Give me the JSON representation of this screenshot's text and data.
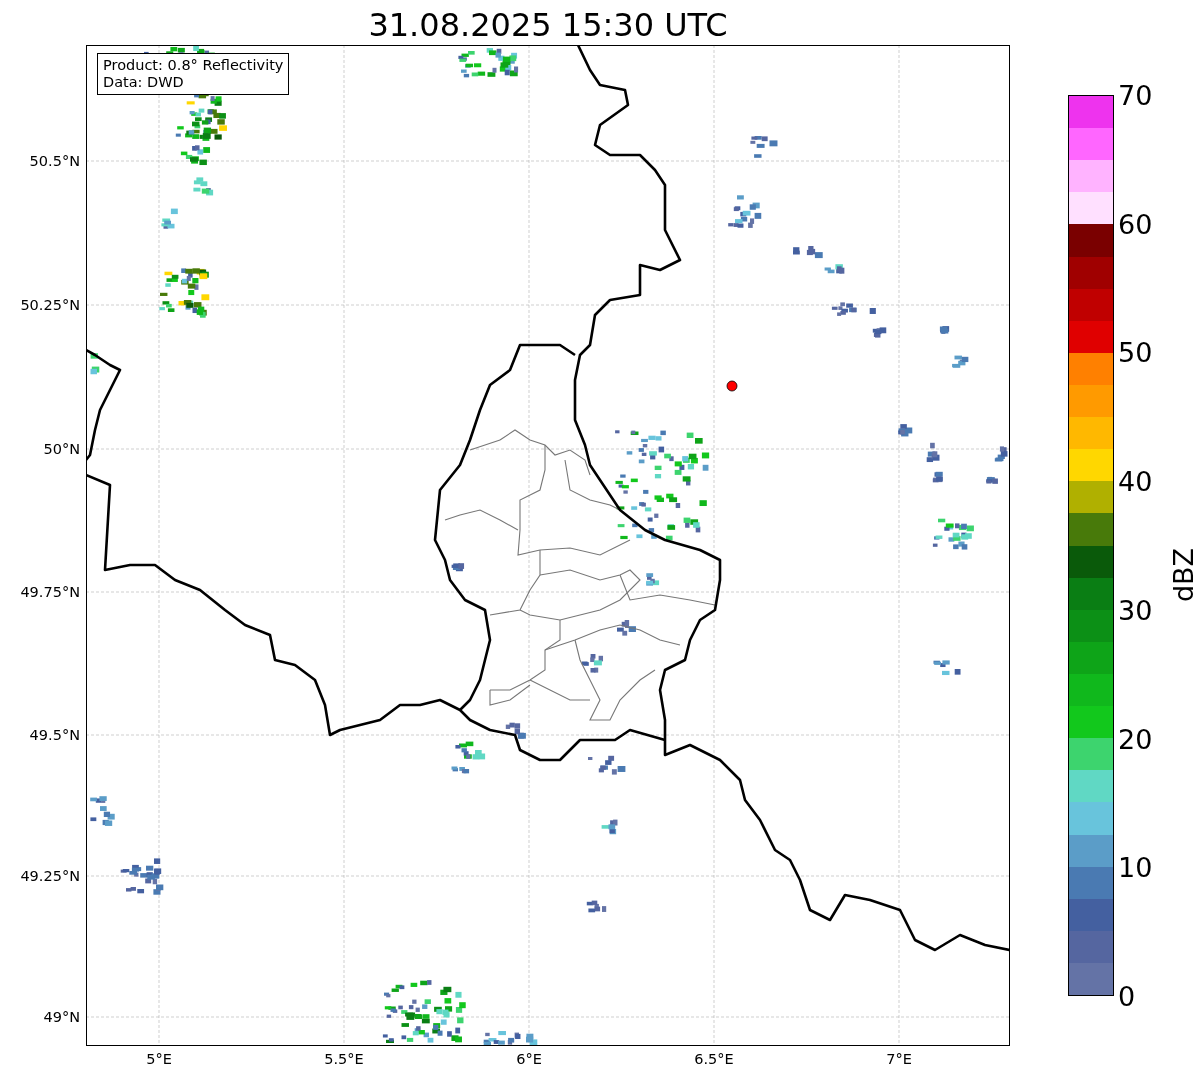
{
  "title": "31.08.2025 15:30 UTC",
  "map": {
    "legend": [
      "Product: 0.8° Reflectivity",
      "Data: DWD"
    ],
    "y_ticks": [
      "50.5°N",
      "50.25°N",
      "50°N",
      "49.75°N",
      "49.5°N",
      "49.25°N",
      "49°N"
    ],
    "x_ticks": [
      "5°E",
      "5.5°E",
      "6°E",
      "6.5°E",
      "7°E"
    ]
  },
  "colorbar": {
    "ticks": [
      "70",
      "60",
      "50",
      "40",
      "30",
      "20",
      "10",
      "0"
    ],
    "colors": [
      {
        "color": "#ee33ee"
      },
      {
        "color": "#ff66ff"
      },
      {
        "color": "#ffb3ff"
      },
      {
        "color": "#ffe0ff"
      },
      {
        "color": "#7a0000"
      },
      {
        "color": "#a00000"
      },
      {
        "color": "#c00000"
      },
      {
        "color": "#e00000"
      },
      {
        "color": "#ff8000"
      },
      {
        "color": "#ff9a00"
      },
      {
        "color": "#ffb800"
      },
      {
        "color": "#ffd700"
      },
      {
        "color": "#b0b000"
      },
      {
        "color": "#487a0a"
      },
      {
        "color": "#0a5a0a"
      },
      {
        "color": "#0a7e14"
      },
      {
        "color": "#0c9016"
      },
      {
        "color": "#0ea418"
      },
      {
        "color": "#10b81c"
      },
      {
        "color": "#12c81c"
      },
      {
        "color": "#3dd46e"
      },
      {
        "color": "#60d8c4"
      },
      {
        "color": "#68c4dc"
      },
      {
        "color": "#5b9dc8"
      },
      {
        "color": "#4a7ab2"
      },
      {
        "color": "#4460a0"
      },
      {
        "color": "#5566a0"
      },
      {
        "color": "#6473a6"
      }
    ],
    "label": "dBZ"
  }
}
